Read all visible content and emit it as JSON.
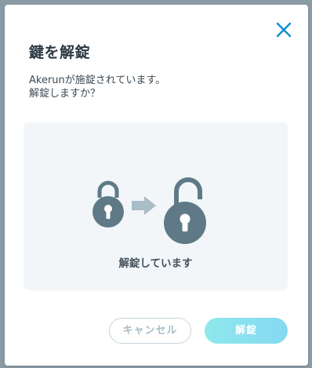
{
  "dialog": {
    "title": "鍵を解錠",
    "message_line1": "Akerunが施錠されています。",
    "message_line2": "解錠しますか？",
    "status_text": "解錠しています",
    "cancel_label": "キャンセル",
    "unlock_label": "解錠",
    "close_icon": "close-icon",
    "locked_icon": "lock-closed-icon",
    "arrow_icon": "arrow-right-icon",
    "unlocked_icon": "lock-open-icon"
  },
  "colors": {
    "overlay": "#8b9ba5",
    "accent": "#0a8fd1",
    "lock": "#5f7a86",
    "arrow": "#a9bdc7",
    "panel": "#f2f6f9"
  }
}
